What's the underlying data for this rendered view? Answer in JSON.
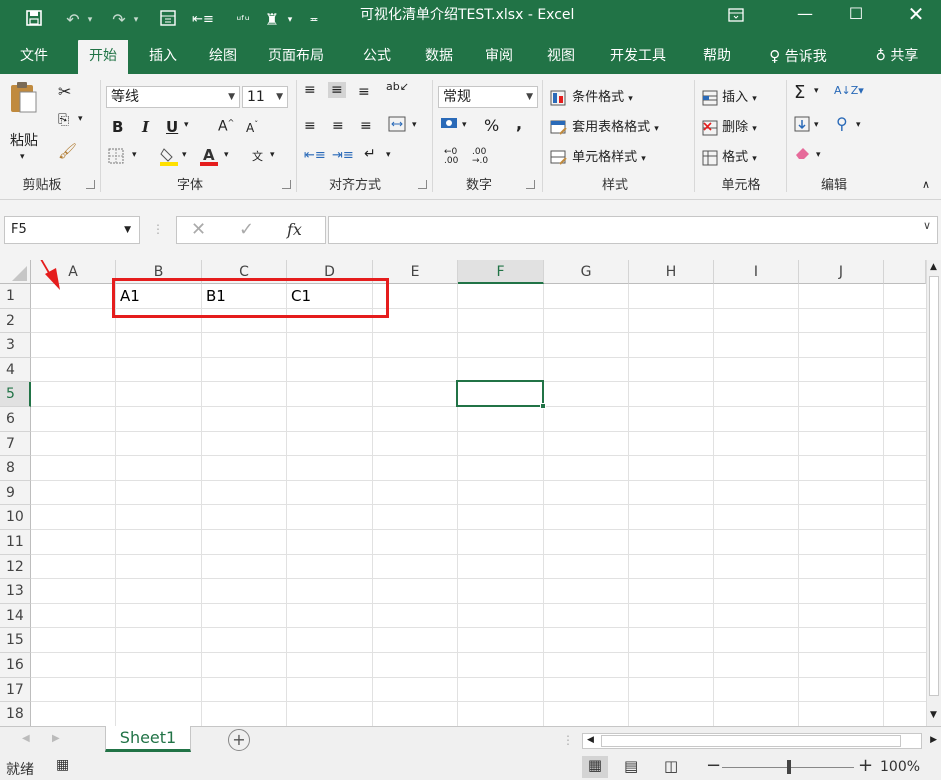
{
  "window": {
    "title": "可视化清单介绍TEST.xlsx  -  Excel"
  },
  "ribbon_tabs": [
    {
      "label": "文件"
    },
    {
      "label": "开始"
    },
    {
      "label": "插入"
    },
    {
      "label": "绘图"
    },
    {
      "label": "页面布局"
    },
    {
      "label": "公式"
    },
    {
      "label": "数据"
    },
    {
      "label": "审阅"
    },
    {
      "label": "视图"
    },
    {
      "label": "开发工具"
    },
    {
      "label": "帮助"
    },
    {
      "label": "告诉我"
    },
    {
      "label": "共享"
    }
  ],
  "clipboard": {
    "paste_label": "粘贴",
    "group_label": "剪贴板"
  },
  "font": {
    "name": "等线",
    "size": "11",
    "group_label": "字体",
    "bold": "B",
    "italic": "I",
    "underline": "U"
  },
  "alignment": {
    "group_label": "对齐方式"
  },
  "number": {
    "format": "常规",
    "group_label": "数字",
    "percent": "%",
    "comma": ","
  },
  "styles": {
    "conditional": "条件格式",
    "table": "套用表格格式",
    "cell_styles": "单元格样式",
    "group_label": "样式"
  },
  "cells": {
    "insert": "插入",
    "delete": "删除",
    "format": "格式",
    "group_label": "单元格"
  },
  "editing": {
    "group_label": "编辑"
  },
  "formula_bar": {
    "name_box": "F5",
    "fx": "fx",
    "value": ""
  },
  "columns": [
    "A",
    "B",
    "C",
    "D",
    "E",
    "F",
    "G",
    "H",
    "I",
    "J"
  ],
  "selected_column": "F",
  "rows": [
    "1",
    "2",
    "3",
    "4",
    "5",
    "6",
    "7",
    "8",
    "9",
    "10",
    "11",
    "12",
    "13",
    "14",
    "15",
    "16",
    "17",
    "18"
  ],
  "selected_row": "5",
  "cell_values": {
    "B1": "A1",
    "C1": "B1",
    "D1": "C1"
  },
  "sheets": [
    {
      "label": "Sheet1"
    }
  ],
  "status": {
    "ready": "就绪",
    "zoom": "100%"
  }
}
